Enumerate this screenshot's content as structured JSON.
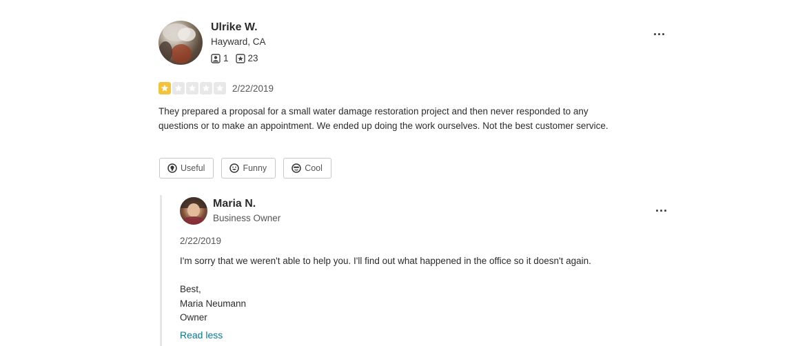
{
  "review": {
    "user": {
      "name": "Ulrike W.",
      "location": "Hayward, CA",
      "friends_count": "1",
      "reviews_count": "23",
      "friends_icon": "friends-icon",
      "reviews_icon": "reviews-icon"
    },
    "more_label": "...",
    "rating": 1,
    "rating_max": 5,
    "date": "2/22/2019",
    "text": "They prepared a proposal for a small water damage restoration project and then never responded to any questions or to make an appointment. We ended up doing the work ourselves. Not the best customer service.",
    "votes": {
      "useful": "Useful",
      "funny": "Funny",
      "cool": "Cool"
    },
    "colors": {
      "star_on": "#f4c33c",
      "star_off": "#e8e8e8",
      "link": "#027a97"
    }
  },
  "reply": {
    "name": "Maria N.",
    "role": "Business Owner",
    "more_label": "...",
    "date": "2/22/2019",
    "text": "I'm sorry that we weren't able to help you.  I'll find out what happened in the office so it doesn't again.\n\nBest,\nMaria Neumann\nOwner",
    "read_less": "Read less"
  }
}
